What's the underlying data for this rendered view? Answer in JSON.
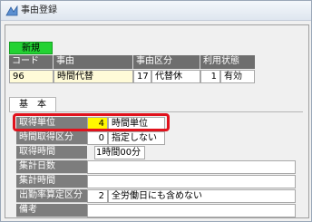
{
  "window": {
    "title": "事由登録"
  },
  "badge": {
    "new_label": "新規"
  },
  "record_header": {
    "columns": [
      "コード",
      "事由",
      "事由区分",
      "利用状態"
    ]
  },
  "record": {
    "code": "96",
    "name": "時間代替",
    "category_no": "17",
    "category_name": "代替休",
    "status_no": "1",
    "status_name": "有効"
  },
  "tabs": {
    "basic": "基　本"
  },
  "fields": {
    "acquisition_unit": {
      "label": "取得単位",
      "code": "4",
      "value": "時間単位"
    },
    "hourly_division": {
      "label": "時間取得区分",
      "code": "0",
      "value": "指定しない"
    },
    "acquisition_time": {
      "label": "取得時間",
      "value": "1時間00分"
    },
    "total_days": {
      "label": "集計日数",
      "value": ""
    },
    "total_hours": {
      "label": "集計時間",
      "value": ""
    },
    "attendance_calc": {
      "label": "出勤率算定区分",
      "code": "2",
      "value": "全労働日にも含めない"
    },
    "remarks": {
      "label": "備考",
      "value": ""
    }
  },
  "colors": {
    "highlight": "#fff700",
    "focus_ring": "#e0121c",
    "new_badge": "#23d233"
  }
}
